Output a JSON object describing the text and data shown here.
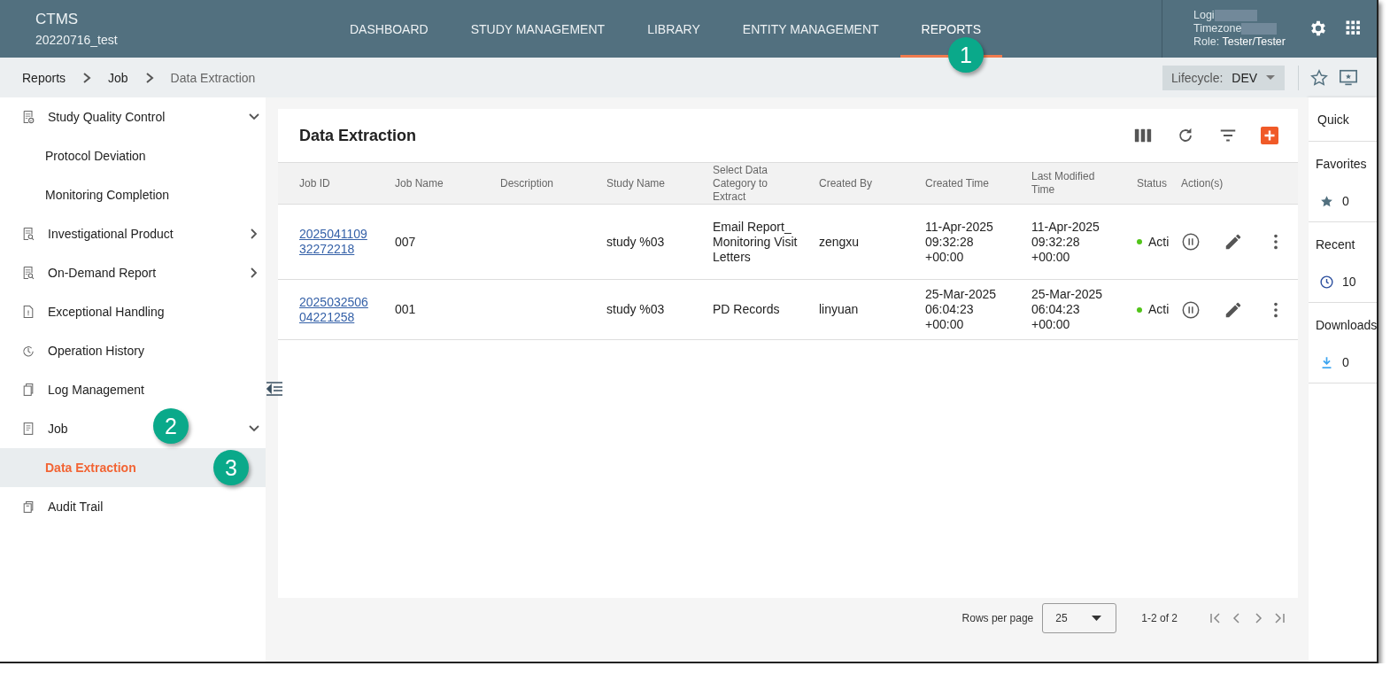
{
  "header": {
    "app_name": "CTMS",
    "project": "20220716_test",
    "nav": [
      {
        "label": "DASHBOARD",
        "selected": false
      },
      {
        "label": "STUDY MANAGEMENT",
        "selected": false
      },
      {
        "label": "LIBRARY",
        "selected": false
      },
      {
        "label": "ENTITY MANAGEMENT",
        "selected": false
      },
      {
        "label": "REPORTS",
        "selected": true
      }
    ],
    "user": {
      "login_label": "Logi",
      "timezone_label": "Timezone",
      "role_label": "Role:",
      "role": "Tester/Tester"
    }
  },
  "breadcrumb": [
    {
      "label": "Reports"
    },
    {
      "label": "Job"
    },
    {
      "label": "Data Extraction"
    }
  ],
  "lifecycle": {
    "label": "Lifecycle:",
    "value": "DEV"
  },
  "sidebar": {
    "items": [
      {
        "label": "Study Quality Control",
        "kind": "group",
        "expanded": true,
        "children": [
          {
            "label": "Protocol Deviation",
            "selected": false
          },
          {
            "label": "Monitoring Completion",
            "selected": false
          }
        ]
      },
      {
        "label": "Investigational Product",
        "kind": "group",
        "expanded": false
      },
      {
        "label": "On-Demand Report",
        "kind": "group",
        "expanded": false
      },
      {
        "label": "Exceptional Handling",
        "kind": "page"
      },
      {
        "label": "Operation History",
        "kind": "page"
      },
      {
        "label": "Log Management",
        "kind": "page"
      },
      {
        "label": "Job",
        "kind": "group",
        "expanded": true,
        "children": [
          {
            "label": "Data Extraction",
            "selected": true
          }
        ]
      },
      {
        "label": "Audit Trail",
        "kind": "page"
      }
    ]
  },
  "table": {
    "title": "Data Extraction",
    "columns": [
      "Job ID",
      "Job Name",
      "Description",
      "Study Name",
      "Select Data Category to Extract",
      "Created By",
      "Created Time",
      "Last Modified Time",
      "Status",
      "Action(s)"
    ],
    "rows": [
      {
        "job_id": "2025041109 32272218",
        "job_name": "007",
        "study_name": "study %03",
        "category": "Email Report_Monitoring Visit Letters",
        "created_by": "zengxu",
        "created_time": "11-Apr-2025 09:32:28 +00:00",
        "last_modified": "11-Apr-2025 09:32:28 +00:00",
        "status": "Acti",
        "color": "#52c41a"
      },
      {
        "job_id": "2025032506 04221258",
        "job_name": "001",
        "study_name": "study %03",
        "category": "PD Records",
        "created_by": "linyuan",
        "created_time": "25-Mar-2025 06:04:23 +00:00",
        "last_modified": "25-Mar-2025 06:04:23 +00:00",
        "status": "Acti",
        "color": "#52c41a"
      }
    ]
  },
  "pagination": {
    "rows_per_page_label": "Rows per page",
    "rows_per_page": "25",
    "range": "1-2 of 2"
  },
  "quick_panel": {
    "title": "Quick",
    "sections": [
      {
        "label": "Favorites",
        "count": "0"
      },
      {
        "label": "Recent",
        "count": "10"
      },
      {
        "label": "Downloads",
        "count": "0"
      }
    ]
  },
  "callouts": [
    {
      "label": "1"
    },
    {
      "label": "2"
    },
    {
      "label": "3"
    }
  ]
}
